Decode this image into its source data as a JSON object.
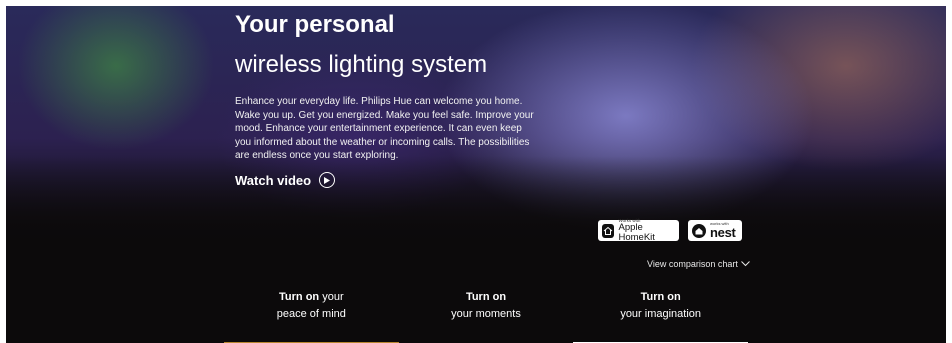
{
  "hero": {
    "title_line1": "Your personal",
    "title_line2": "wireless lighting system",
    "intro": "Enhance your everyday life. Philips Hue can welcome you home. Wake you up. Get you energized. Make you feel safe. Improve your mood. Enhance your entertainment experience. It can even keep you informed about the weather or incoming calls. The possibilities are endless once you start exploring.",
    "watch_video_label": "Watch video",
    "watch_video_icon": "play-icon"
  },
  "badges": {
    "homekit": {
      "small": "Works with",
      "label": "Apple HomeKit",
      "icon": "home-icon"
    },
    "nest": {
      "small": "works with",
      "label": "nest",
      "icon": "nest-home-icon"
    }
  },
  "comparison": {
    "label": "View comparison chart",
    "icon": "chevron-down-icon"
  },
  "tabs": [
    {
      "bold": "Turn on",
      "rest": " your",
      "line2": "peace of mind",
      "underline": "#b8862e"
    },
    {
      "bold": "Turn on",
      "rest": "",
      "line2": "your moments",
      "underline": ""
    },
    {
      "bold": "Turn on",
      "rest": "",
      "line2": "your imagination",
      "underline": "#ffffff",
      "active": true
    }
  ],
  "colors": {
    "background": "#0c0a0b",
    "accent_underline_gold": "#b8862e",
    "active_underline": "#ffffff"
  }
}
